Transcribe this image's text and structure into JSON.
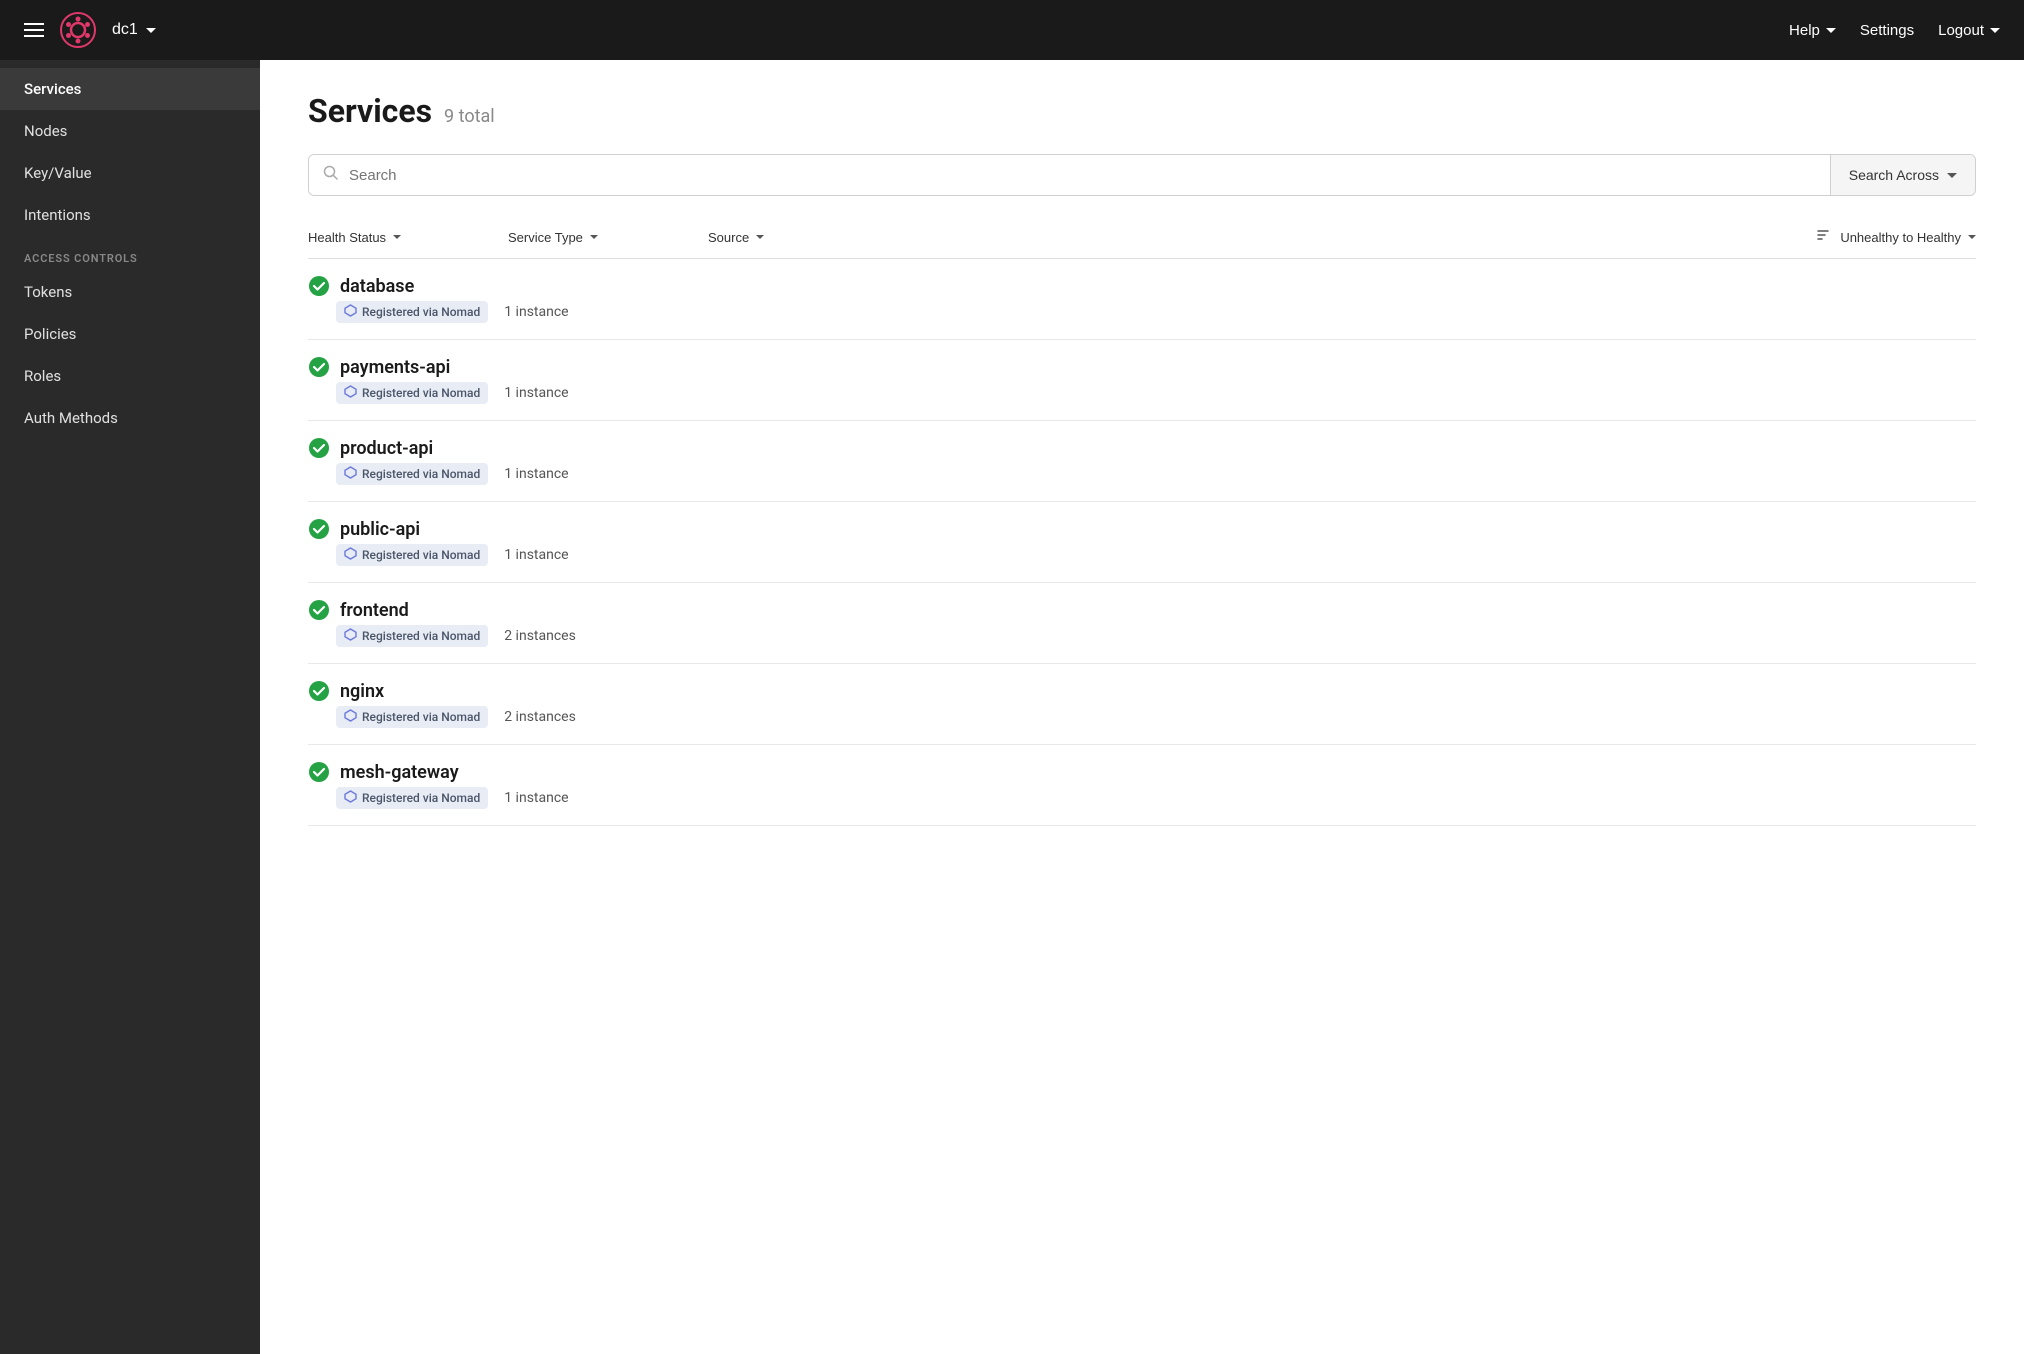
{
  "topnav": {
    "datacenter": "dc1",
    "help_label": "Help",
    "settings_label": "Settings",
    "logout_label": "Logout"
  },
  "sidebar": {
    "nav_items": [
      {
        "label": "Services",
        "active": true,
        "id": "services"
      },
      {
        "label": "Nodes",
        "active": false,
        "id": "nodes"
      },
      {
        "label": "Key/Value",
        "active": false,
        "id": "keyvalue"
      },
      {
        "label": "Intentions",
        "active": false,
        "id": "intentions"
      }
    ],
    "access_controls_label": "ACCESS CONTROLS",
    "access_items": [
      {
        "label": "Tokens",
        "id": "tokens"
      },
      {
        "label": "Policies",
        "id": "policies"
      },
      {
        "label": "Roles",
        "id": "roles"
      },
      {
        "label": "Auth Methods",
        "id": "auth-methods"
      }
    ]
  },
  "main": {
    "page_title": "Services",
    "page_count": "9 total",
    "search_placeholder": "Search",
    "search_across_label": "Search Across",
    "columns": {
      "health_status": "Health Status",
      "service_type": "Service Type",
      "source": "Source",
      "sort_label": "Unhealthy to Healthy"
    },
    "services": [
      {
        "name": "database",
        "source": "Registered via Nomad",
        "instances": "1 instance",
        "healthy": true
      },
      {
        "name": "payments-api",
        "source": "Registered via Nomad",
        "instances": "1 instance",
        "healthy": true
      },
      {
        "name": "product-api",
        "source": "Registered via Nomad",
        "instances": "1 instance",
        "healthy": true
      },
      {
        "name": "public-api",
        "source": "Registered via Nomad",
        "instances": "1 instance",
        "healthy": true
      },
      {
        "name": "frontend",
        "source": "Registered via Nomad",
        "instances": "2 instances",
        "healthy": true
      },
      {
        "name": "nginx",
        "source": "Registered via Nomad",
        "instances": "2 instances",
        "healthy": true
      },
      {
        "name": "mesh-gateway",
        "source": "Registered via Nomad",
        "instances": "1 instance",
        "healthy": true
      }
    ]
  },
  "icons": {
    "checkmark": "✔",
    "chevron_down": "▾",
    "nomad_symbol": "⬡",
    "sort_icon": "⇅",
    "search_glass": "🔍"
  },
  "colors": {
    "sidebar_bg": "#2a2a2a",
    "topnav_bg": "#1a1a1a",
    "active_bg": "#3a3a3a",
    "green": "#25a244",
    "nomad_badge_bg": "#e8ecf5",
    "nomad_icon_color": "#6b7adb"
  }
}
